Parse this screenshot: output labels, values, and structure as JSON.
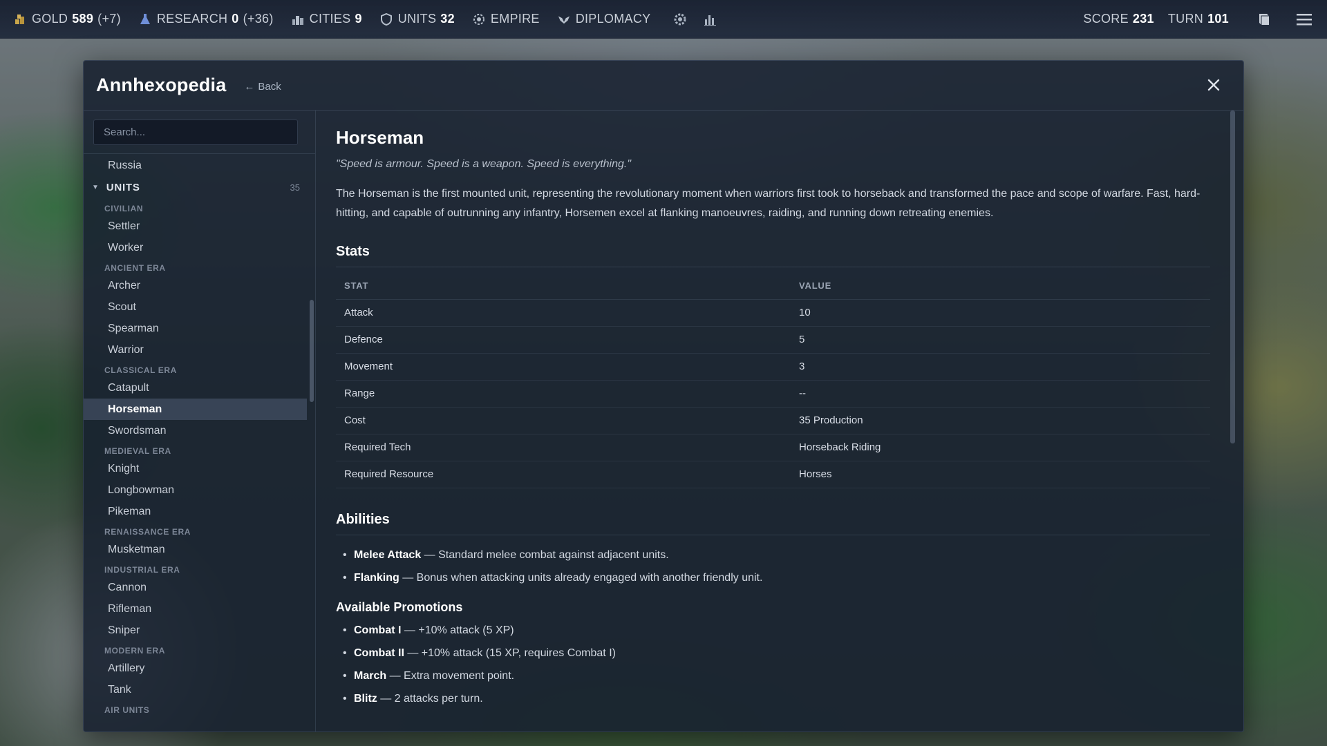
{
  "topbar": {
    "gold": {
      "label": "GOLD",
      "value": "589",
      "delta": "(+7)"
    },
    "research": {
      "label": "RESEARCH",
      "value": "0",
      "delta": "(+36)"
    },
    "cities": {
      "label": "CITIES",
      "value": "9"
    },
    "units": {
      "label": "UNITS",
      "value": "32"
    },
    "empire": {
      "label": "EMPIRE"
    },
    "diplomacy": {
      "label": "DIPLOMACY"
    },
    "score": {
      "label": "SCORE",
      "value": "231"
    },
    "turn": {
      "label": "TURN",
      "value": "101"
    }
  },
  "modal": {
    "title": "Annhexopedia",
    "back_label": "Back",
    "back_arrow": "←"
  },
  "sidebar": {
    "search_placeholder": "Search...",
    "top_item": "Russia",
    "category": {
      "label": "UNITS",
      "count": "35"
    },
    "groups": [
      {
        "label": "CIVILIAN",
        "items": [
          "Settler",
          "Worker"
        ]
      },
      {
        "label": "ANCIENT ERA",
        "items": [
          "Archer",
          "Scout",
          "Spearman",
          "Warrior"
        ]
      },
      {
        "label": "CLASSICAL ERA",
        "items": [
          "Catapult",
          "Horseman",
          "Swordsman"
        ]
      },
      {
        "label": "MEDIEVAL ERA",
        "items": [
          "Knight",
          "Longbowman",
          "Pikeman"
        ]
      },
      {
        "label": "RENAISSANCE ERA",
        "items": [
          "Musketman"
        ]
      },
      {
        "label": "INDUSTRIAL ERA",
        "items": [
          "Cannon",
          "Rifleman",
          "Sniper"
        ]
      },
      {
        "label": "MODERN ERA",
        "items": [
          "Artillery",
          "Tank"
        ]
      },
      {
        "label": "AIR UNITS",
        "items": []
      }
    ],
    "selected": "Horseman"
  },
  "content": {
    "title": "Horseman",
    "quote": "\"Speed is armour. Speed is a weapon. Speed is everything.\"",
    "description": "The Horseman is the first mounted unit, representing the revolutionary moment when warriors first took to horseback and transformed the pace and scope of warfare. Fast, hard-hitting, and capable of outrunning any infantry, Horsemen excel at flanking manoeuvres, raiding, and running down retreating enemies.",
    "stats_title": "Stats",
    "stats_headers": [
      "STAT",
      "VALUE"
    ],
    "stats": [
      [
        "Attack",
        "10"
      ],
      [
        "Defence",
        "5"
      ],
      [
        "Movement",
        "3"
      ],
      [
        "Range",
        "--"
      ],
      [
        "Cost",
        "35 Production"
      ],
      [
        "Required Tech",
        "Horseback Riding"
      ],
      [
        "Required Resource",
        "Horses"
      ]
    ],
    "abilities_title": "Abilities",
    "abilities": [
      {
        "name": "Melee Attack",
        "text": " — Standard melee combat against adjacent units."
      },
      {
        "name": "Flanking",
        "text": " — Bonus when attacking units already engaged with another friendly unit."
      }
    ],
    "promotions_title": "Available Promotions",
    "promotions": [
      {
        "name": "Combat I",
        "text": " — +10% attack (5 XP)"
      },
      {
        "name": "Combat II",
        "text": " — +10% attack (15 XP, requires Combat I)"
      },
      {
        "name": "March",
        "text": " — Extra movement point."
      },
      {
        "name": "Blitz",
        "text": " — 2 attacks per turn."
      }
    ]
  },
  "colors": {
    "accent_gold": "#c9a64a",
    "panel_bg": "#161f2e",
    "text_white": "#ffffff"
  },
  "icons": {
    "gold": "gold-coins-icon",
    "research": "flask-icon",
    "cities": "city-icon",
    "units": "shield-icon",
    "empire": "laurel-icon",
    "diplomacy": "eagle-icon",
    "settings": "gear-icon",
    "stats": "bar-chart-icon",
    "codex": "book-icon",
    "menu": "hamburger-menu-icon",
    "close": "close-icon"
  }
}
